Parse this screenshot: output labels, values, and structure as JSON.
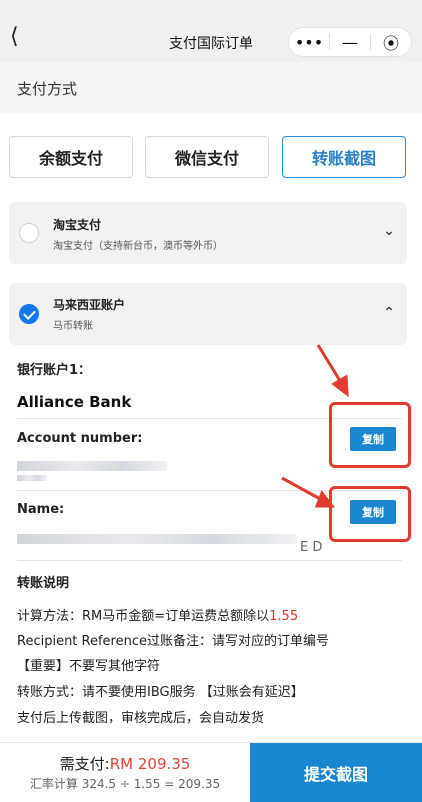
{
  "header": {
    "back_icon": "chevron-left-icon",
    "title": "支付国际订单",
    "capsule": {
      "more_glyph": "•••",
      "minimize_glyph": "—",
      "close_glyph": "⦿"
    }
  },
  "payment_section": {
    "label": "支付方式"
  },
  "methods": [
    "余额支付",
    "微信支付",
    "转账截图"
  ],
  "active_method": "转账截图",
  "options": [
    {
      "title": "淘宝支付",
      "subtitle": "淘宝支付（支持新台币，澳币等外币）",
      "selected": false,
      "expanded": false
    },
    {
      "title": "马来西亚账户",
      "subtitle": "马币转账",
      "selected": true,
      "expanded": true
    }
  ],
  "bank": {
    "account_label": "银行账户1：",
    "bank_name": "Alliance Bank",
    "account_number_label": "Account number:",
    "account_number_tail": "",
    "name_label": "Name:",
    "name_tail": "E D",
    "copy_label": "复制"
  },
  "instructions": {
    "title": "转账说明",
    "line1_prefix": "计算方法：RM马币金额=订单运费总额除以",
    "rate": "1.55",
    "line2": "Recipient Reference过账备注：请写对应的订单编号",
    "line3": "【重要】不要写其他字符",
    "line4": "转账方式：请不要使用IBG服务 【过账会有延迟】",
    "line5": "支付后上传截图，审核完成后，会自动发货"
  },
  "footer": {
    "due_label": "需支付:",
    "due_amount": "RM 209.35",
    "calc": "汇率计算 324.5 ÷ 1.55 = 209.35",
    "submit_label": "提交截图"
  },
  "colors": {
    "accent": "#1a86d0",
    "highlight": "#e23b2f",
    "amount": "#e14637"
  }
}
